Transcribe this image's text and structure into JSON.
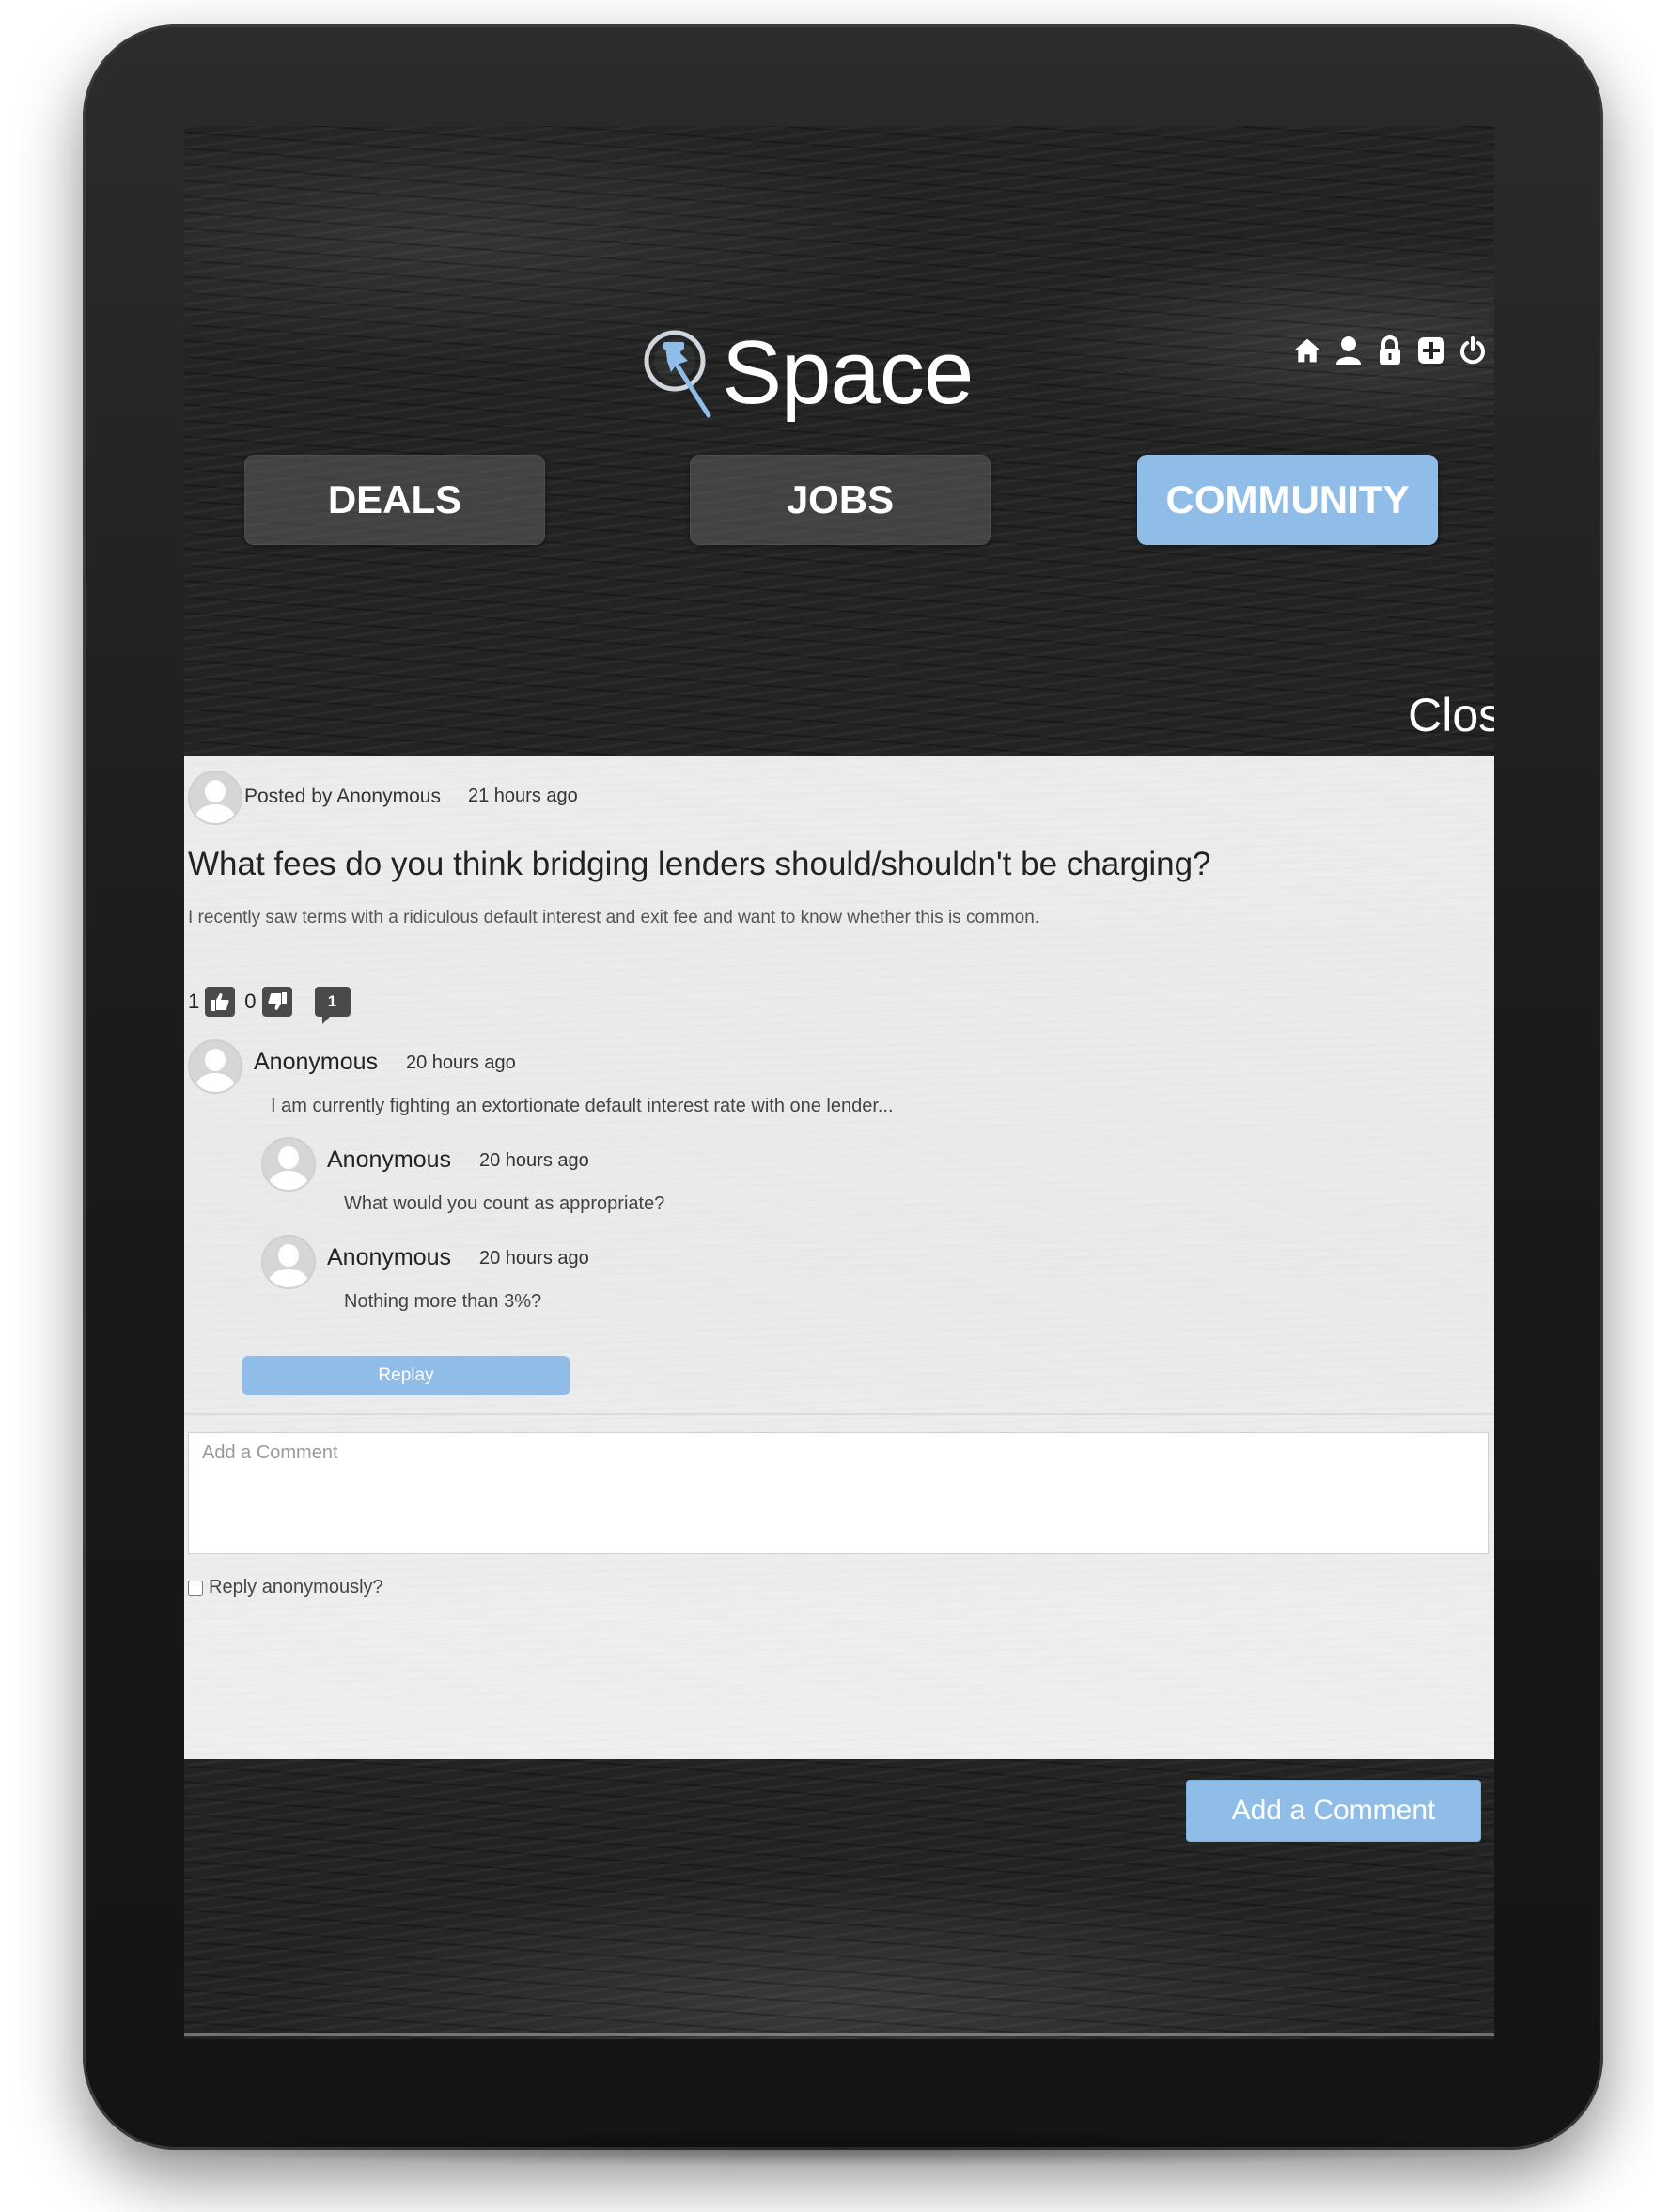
{
  "app": {
    "logo_text": "Space"
  },
  "header_icons": [
    "home-icon",
    "user-icon",
    "lock-icon",
    "plus-square-icon",
    "power-icon"
  ],
  "nav": {
    "tabs": [
      {
        "label": "DEALS",
        "active": false
      },
      {
        "label": "JOBS",
        "active": false
      },
      {
        "label": "COMMUNITY",
        "active": true
      }
    ],
    "close_label": "Close"
  },
  "post": {
    "posted_by": "Posted by Anonymous",
    "time": "21 hours ago",
    "title": "What fees do you think bridging lenders should/shouldn't be charging?",
    "body": "I recently saw terms with a ridiculous default interest and exit fee and want to know whether this is common.",
    "likes": "1",
    "dislikes": "0",
    "comment_count": "1"
  },
  "comments": [
    {
      "author": "Anonymous",
      "time": "20 hours ago",
      "text": "I am currently fighting an extortionate default interest rate with one lender..."
    },
    {
      "author": "Anonymous",
      "time": "20 hours ago",
      "text": "What would you count as appropriate?"
    },
    {
      "author": "Anonymous",
      "time": "20 hours ago",
      "text": "Nothing more than 3%?"
    }
  ],
  "reply_button_label": "Replay",
  "comment_form": {
    "placeholder": "Add a Comment",
    "value": "",
    "anonymous_label": "Reply anonymously?",
    "anonymous_checked": false,
    "submit_label": "Add a Comment"
  },
  "colors": {
    "accent": "#8fbde8",
    "panel_bg": "#ebecee",
    "tablet_frame": "#1f1f1f"
  }
}
